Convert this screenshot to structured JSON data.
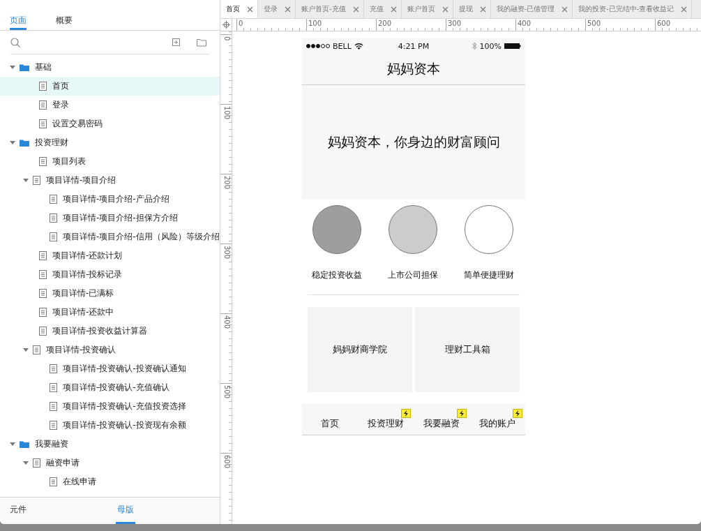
{
  "sidebar": {
    "tabs": [
      {
        "label": "页面",
        "selected": true
      },
      {
        "label": "概要",
        "selected": false
      }
    ],
    "tree": [
      {
        "label": "基础",
        "kind": "folder",
        "expanded": true,
        "selected": false,
        "children": [
          {
            "label": "首页",
            "kind": "page",
            "selected": true
          },
          {
            "label": "登录",
            "kind": "page",
            "selected": false
          },
          {
            "label": "设置交易密码",
            "kind": "page",
            "selected": false
          }
        ]
      },
      {
        "label": "投资理财",
        "kind": "folder",
        "expanded": true,
        "selected": false,
        "children": [
          {
            "label": "项目列表",
            "kind": "page",
            "selected": false
          },
          {
            "label": "项目详情-项目介绍",
            "kind": "page",
            "expanded": true,
            "selected": false,
            "children": [
              {
                "label": "项目详情-项目介绍-产品介绍",
                "kind": "page",
                "selected": false
              },
              {
                "label": "项目详情-项目介绍-担保方介绍",
                "kind": "page",
                "selected": false
              },
              {
                "label": "项目详情-项目介绍-信用（风险）等级介绍",
                "kind": "page",
                "selected": false
              }
            ]
          },
          {
            "label": "项目详情-还款计划",
            "kind": "page",
            "selected": false
          },
          {
            "label": "项目详情-投标记录",
            "kind": "page",
            "selected": false
          },
          {
            "label": "项目详情-已满标",
            "kind": "page",
            "selected": false
          },
          {
            "label": "项目详情-还款中",
            "kind": "page",
            "selected": false
          },
          {
            "label": "项目详情-投资收益计算器",
            "kind": "page",
            "selected": false
          },
          {
            "label": "项目详情-投资确认",
            "kind": "page",
            "expanded": true,
            "selected": false,
            "children": [
              {
                "label": "项目详情-投资确认-投资确认通知",
                "kind": "page",
                "selected": false
              },
              {
                "label": "项目详情-投资确认-充值确认",
                "kind": "page",
                "selected": false
              },
              {
                "label": "项目详情-投资确认-充值投资选择",
                "kind": "page",
                "selected": false
              },
              {
                "label": "项目详情-投资确认-投资现有余额",
                "kind": "page",
                "selected": false
              }
            ]
          }
        ]
      },
      {
        "label": "我要融资",
        "kind": "folder",
        "expanded": true,
        "selected": false,
        "children": [
          {
            "label": "融资申请",
            "kind": "page",
            "expanded": true,
            "selected": false,
            "children": [
              {
                "label": "在线申请",
                "kind": "page",
                "selected": false
              }
            ]
          }
        ]
      }
    ],
    "bottom_tabs": [
      {
        "label": "元件",
        "selected": false
      },
      {
        "label": "母版",
        "selected": true
      }
    ]
  },
  "doc_tabs": [
    {
      "label": "首页",
      "selected": true
    },
    {
      "label": "登录",
      "selected": false
    },
    {
      "label": "账户首页-充值",
      "selected": false
    },
    {
      "label": "充值",
      "selected": false
    },
    {
      "label": "账户首页",
      "selected": false
    },
    {
      "label": "提现",
      "selected": false
    },
    {
      "label": "我的融资-已借管理",
      "selected": false
    },
    {
      "label": "我的投资-已完结中-查看收益记",
      "selected": false
    }
  ],
  "rulers": {
    "horizontal": [
      "0",
      "100",
      "200",
      "300",
      "400",
      "500",
      "600"
    ],
    "vertical": [
      "0",
      "100",
      "200",
      "300",
      "400",
      "500",
      "600"
    ]
  },
  "phone": {
    "status": {
      "carrier": "BELL",
      "time": "4:21 PM",
      "battery": "100%"
    },
    "title": "妈妈资本",
    "banner": "妈妈资本，你身边的财富顾问",
    "features": [
      {
        "label": "稳定投资收益",
        "color": "#9e9e9e"
      },
      {
        "label": "上市公司担保",
        "color": "#cccccc"
      },
      {
        "label": "简单便捷理财",
        "color": "#ffffff"
      }
    ],
    "cards": [
      "妈妈财商学院",
      "理财工具箱"
    ],
    "tab_bar": [
      {
        "label": "首页",
        "badge": false
      },
      {
        "label": "投资理财",
        "badge": true
      },
      {
        "label": "我要融资",
        "badge": true
      },
      {
        "label": "我的账户",
        "badge": true
      }
    ]
  }
}
